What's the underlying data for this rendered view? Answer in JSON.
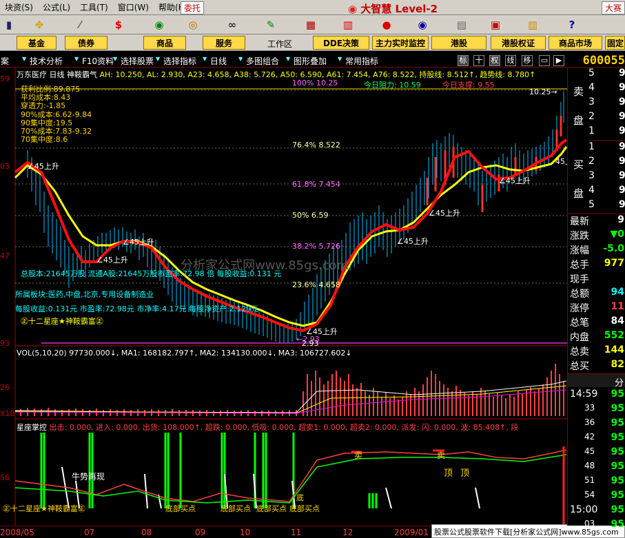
{
  "menubar": {
    "items": [
      "块资(S)",
      "公式(L)",
      "工具(T)",
      "窗口(W)",
      "帮助(H)"
    ],
    "weituo": "委托",
    "brand": "大智慧 Level-2",
    "contest": "大赛"
  },
  "tabs": [
    "基金",
    "债券",
    "商品",
    "服务",
    "DDE决策",
    "主力实时监控",
    "港股",
    "港股权证",
    "商品市场",
    "固定"
  ],
  "workzone": "工作区",
  "chartbar": {
    "items": [
      "案",
      "技术分析",
      "F10资料",
      "选择股票",
      "选择指标",
      "日线",
      "多图组合",
      "图形叠加",
      "常用指标"
    ],
    "icons": [
      "标",
      "十",
      "权",
      "线",
      "移"
    ],
    "stock_code": "600055"
  },
  "main_header": {
    "name": "万东医疗",
    "period": "日线",
    "indicator": "神鞍霸气",
    "params": "AH: 10.250, AL: 2.930, A23: 4.658, A38: 5.726, A50: 6.590, A61: 7.454, A76: 8.522, 持股线: 8.512↑, 趋势线: 8.780↑"
  },
  "profit_block": [
    "获利比例:89.875",
    "平均成本:8.43",
    "穿透力:-1.85",
    "90%成本:6.62-9.84",
    "90集中度:19.5",
    "70%成本:7.83-9.32",
    "70集中度:8.6"
  ],
  "fib_labels": [
    "100%  10.25",
    "76.4%  8.522",
    "61.8%  7.454",
    "50%  6.59",
    "38.2%  5.726",
    "23.6%  4.658"
  ],
  "resistance": "今日阻力: 10.59",
  "support": "今日支撑: 9.55",
  "price_markers": {
    "high": "10.25→",
    "low": "2.93",
    "low_arrow": "←2.93"
  },
  "annotations": [
    "∠45上升",
    "∠45上升",
    "∠45上升",
    "∠45上升",
    "∠45上升",
    "∠45上升",
    "∠45上升",
    "45上升"
  ],
  "fundamentals": [
    "总股本:21645万股  流通A股:21645万股市盈率:72.98 倍  每股收益:0.131 元",
    "所属板块:医药,中盘,北京,专用设备制造业",
    "每股收益:0.131元  市盈率:72.98元  市净率:4.17元  每股净资产:2.129元"
  ],
  "brand_tag": "㊣十二星座★神鞍霸富㊣",
  "watermark": "分析家公式网www.85gs.com",
  "left_axis": [
    "59",
    "03",
    "47",
    "93",
    "26",
    "X10",
    "56"
  ],
  "vol_header": "VOL(5,10,20) 97730.000↓,  MA1: 168182.797↑,  MA2: 134130.000↓,  MA3: 106727.602↓",
  "lower_header": {
    "name": "星座掌控",
    "values": "出击: 0.000,  进入: 0.000,  出货: 108.000↑,  超跌: 0.000,  低吸: 0.000,  超卖1: 0.000,  超卖2: 0.000,  派发: 闪: 0.000,  波: 85.408↑,  段"
  },
  "lower_labels": [
    "牛势再现",
    "卖",
    "卖",
    "顶",
    "顶",
    "底部买点",
    "底部买点",
    "底部买点",
    "底部买点",
    "㊣十二星座★神鞍霸富㊣",
    "底"
  ],
  "dates": [
    "2008/05",
    "07",
    "08",
    "09",
    "10",
    "11",
    "12",
    "2009/01"
  ],
  "footer": "股票公式股票软件下载[分析家公式网]www.85gs.com",
  "right_panel": {
    "sell_label": [
      "卖",
      "盘"
    ],
    "buy_label": [
      "买",
      "盘"
    ],
    "sell_rows": [
      "5",
      "4",
      "3",
      "2",
      "1"
    ],
    "buy_rows": [
      "1",
      "2",
      "3",
      "4",
      "5"
    ],
    "sell_vals": [
      "9",
      "9",
      "9",
      "9",
      "9"
    ],
    "buy_vals": [
      "9",
      "9",
      "9",
      "9",
      "9"
    ],
    "stats": [
      {
        "label": "最新",
        "value": "9"
      },
      {
        "label": "涨跌",
        "value": "▼0"
      },
      {
        "label": "涨幅",
        "value": "-5.0"
      },
      {
        "label": "总手",
        "value": "977"
      },
      {
        "label": "现手",
        "value": ""
      },
      {
        "label": "总额",
        "value": "94"
      },
      {
        "label": "涨停",
        "value": "11"
      },
      {
        "label": "总笔",
        "value": "84"
      },
      {
        "label": "内盘",
        "value": "552"
      },
      {
        "label": "总卖",
        "value": "144"
      },
      {
        "label": "总买",
        "value": "82"
      }
    ],
    "fen": "分",
    "ticks": [
      {
        "t": "14:59",
        "v": "95"
      },
      {
        "t": "33",
        "v": "95"
      },
      {
        "t": "36",
        "v": "95"
      },
      {
        "t": "42",
        "v": "95"
      },
      {
        "t": "45",
        "v": "95"
      },
      {
        "t": "48",
        "v": "95"
      },
      {
        "t": "51",
        "v": "95"
      },
      {
        "t": "54",
        "v": "95"
      },
      {
        "t": "15:00",
        "v": "95"
      },
      {
        "t": "03",
        "v": "95"
      }
    ]
  }
}
